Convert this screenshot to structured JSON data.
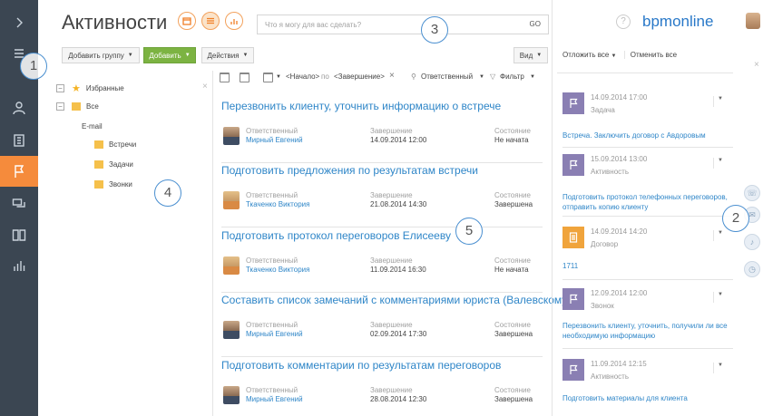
{
  "header": {
    "title": "Активности",
    "search_placeholder": "Что я могу для вас сделать?",
    "search_go": "GO",
    "help": "?",
    "logo": "bpmonline"
  },
  "toolbar": {
    "add_group": "Добавить группу",
    "add": "Добавить",
    "actions": "Действия",
    "view": "Вид"
  },
  "callouts": [
    "1",
    "2",
    "3",
    "4",
    "5"
  ],
  "tree": {
    "items": [
      {
        "label": "Избранные"
      },
      {
        "label": "Все"
      },
      {
        "label": "E-mail"
      },
      {
        "label": "Встречи"
      },
      {
        "label": "Задачи"
      },
      {
        "label": "Звонки"
      }
    ],
    "close": "×"
  },
  "filters": {
    "start": "<Начало>",
    "to": "по",
    "end": "<Завершение>",
    "clear": "×",
    "owner": "Ответственный",
    "filter": "Фильтр"
  },
  "activity_labels": {
    "owner": "Ответственный",
    "due": "Завершение",
    "status": "Состояние"
  },
  "activities": [
    {
      "title": "Перезвонить клиенту, уточнить информацию о встрече",
      "owner": "Мирный Евгений",
      "due": "14.09.2014 12:00",
      "status": "Не начата"
    },
    {
      "title": "Подготовить предложения по результатам встречи",
      "owner": "Ткаченко Виктория",
      "due": "21.08.2014 14:30",
      "status": "Завершена"
    },
    {
      "title": "Подготовить протокол переговоров Елисееву",
      "owner": "Ткаченко Виктория",
      "due": "11.09.2014 16:30",
      "status": "Не начата"
    },
    {
      "title": "Составить список замечаний с комментариями юриста (Валевскому)",
      "owner": "Мирный Евгений",
      "due": "02.09.2014 17:30",
      "status": "Завершена"
    },
    {
      "title": "Подготовить комментарии по результатам переговоров",
      "owner": "Мирный Евгений",
      "due": "28.08.2014 12:30",
      "status": "Завершена"
    }
  ],
  "right_panel": {
    "postpone_all": "Отложить все",
    "cancel_all": "Отменить все",
    "close": "×",
    "feed": [
      {
        "date": "14.09.2014 17:00",
        "type": "Задача",
        "text": "Встреча. Заключить договор с Авдоровым",
        "icon": "flag-icon"
      },
      {
        "date": "15.09.2014 13:00",
        "type": "Активность",
        "text": "Подготовить протокол телефонных переговоров, отправить копию клиенту",
        "icon": "flag-icon"
      },
      {
        "date": "14.09.2014 14:20",
        "type": "Договор",
        "text": "1711",
        "icon": "document-icon"
      },
      {
        "date": "12.09.2014 12:00",
        "type": "Звонок",
        "text": "Перезвонить клиенту, уточнить, получили ли все необходимую информацию",
        "icon": "flag-icon"
      },
      {
        "date": "11.09.2014 12:15",
        "type": "Активность",
        "text": "Подготовить материалы для клиента",
        "icon": "flag-icon"
      }
    ]
  },
  "colors": {
    "sidebar": "#3b4652",
    "accent": "#f58b3c",
    "link": "#2f86c8",
    "add_button": "#7cb342",
    "task_icon": "#8a7fb3",
    "doc_icon": "#f0a43c"
  }
}
